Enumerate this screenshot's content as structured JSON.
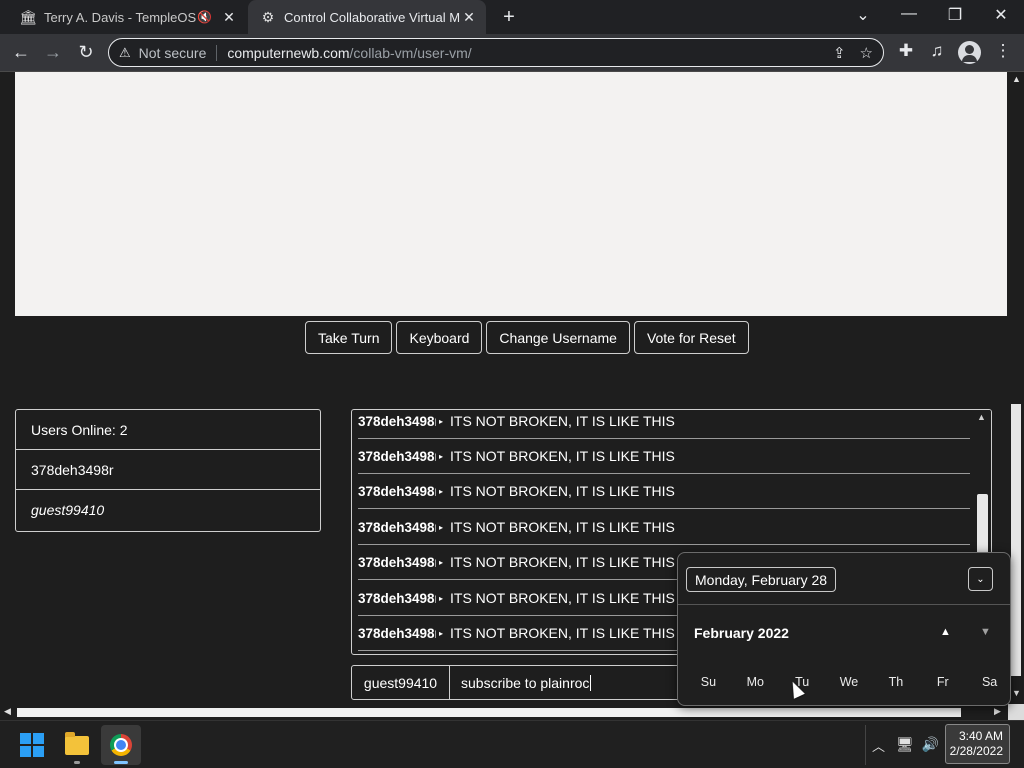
{
  "browser": {
    "tabs": [
      {
        "title": "Terry A. Davis - TempleOS An",
        "active": false,
        "muted_icon": "speaker-muted-icon"
      },
      {
        "title": "Control Collaborative Virtual Ma",
        "active": true
      }
    ],
    "address": {
      "security_label": "Not secure",
      "host": "computernewb.com",
      "path": "/collab-vm/user-vm/"
    }
  },
  "vm": {
    "buttons": [
      "Take Turn",
      "Keyboard",
      "Change Username",
      "Vote for Reset"
    ]
  },
  "users": {
    "header": "Users Online: 2",
    "list": [
      "378deh3498r",
      "guest99410"
    ]
  },
  "chat": {
    "messages": [
      {
        "user": "378deh3498r",
        "text": "ITS NOT BROKEN, IT IS LIKE THIS"
      },
      {
        "user": "378deh3498r",
        "text": "ITS NOT BROKEN, IT IS LIKE THIS"
      },
      {
        "user": "378deh3498r",
        "text": "ITS NOT BROKEN, IT IS LIKE THIS"
      },
      {
        "user": "378deh3498r",
        "text": "ITS NOT BROKEN, IT IS LIKE THIS"
      },
      {
        "user": "378deh3498r",
        "text": "ITS NOT BROKEN, IT IS LIKE THIS"
      },
      {
        "user": "378deh3498r",
        "text": "ITS NOT BROKEN, IT IS LIKE THIS"
      },
      {
        "user": "378deh3498r",
        "text": "ITS NOT BROKEN, IT IS LIKE THIS"
      }
    ],
    "username": "guest99410",
    "input_value": "subscribe to plainroc"
  },
  "datepicker": {
    "selected_date": "Monday, February 28",
    "month_label": "February 2022",
    "weekdays": [
      "Su",
      "Mo",
      "Tu",
      "We",
      "Th",
      "Fr",
      "Sa"
    ]
  },
  "taskbar": {
    "time": "3:40 AM",
    "date": "2/28/2022"
  }
}
